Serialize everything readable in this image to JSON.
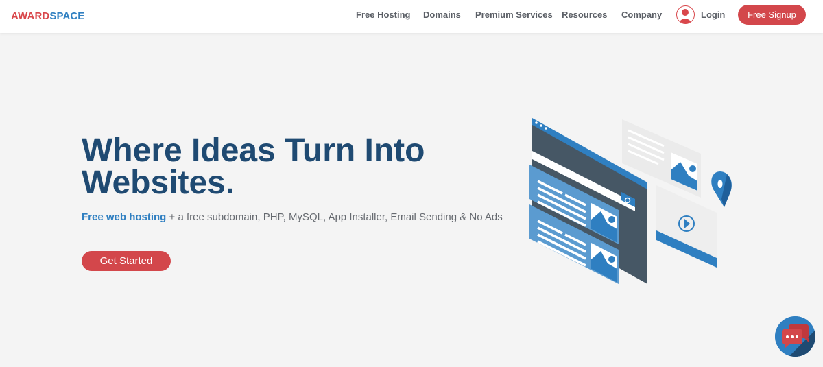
{
  "header": {
    "logo": {
      "part1": "AWARD",
      "part2": "SPACE"
    },
    "nav": [
      {
        "label": "Free Hosting"
      },
      {
        "label": "Domains"
      },
      {
        "label": "Premium Services"
      },
      {
        "label": "Resources"
      },
      {
        "label": "Company"
      }
    ],
    "login_label": "Login",
    "signup_label": "Free Signup"
  },
  "hero": {
    "title": "Where Ideas Turn Into Websites.",
    "subtitle_link": "Free web hosting",
    "subtitle_rest": " + a free subdomain, PHP, MySQL, App Installer, Email Sending & No Ads",
    "cta_label": "Get Started"
  },
  "icons": {
    "user": "user-avatar-icon",
    "chat": "chat-bubbles-icon",
    "illustration": "website-builder-illustration"
  },
  "colors": {
    "brand_red": "#d3474b",
    "brand_blue": "#2f7fc1",
    "title_navy": "#1f4a72",
    "background": "#f4f4f4"
  }
}
